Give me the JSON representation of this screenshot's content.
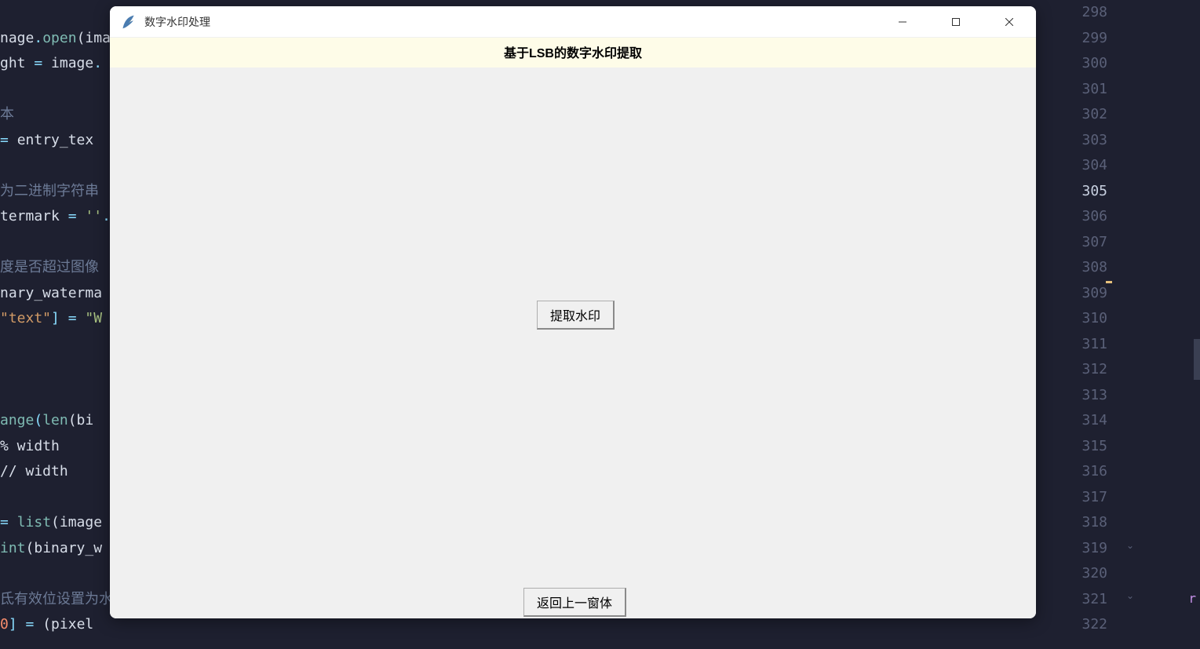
{
  "code_left": {
    "lines": [
      {
        "frag": [
          {
            "t": "",
            "c": ""
          }
        ]
      },
      {
        "frag": [
          {
            "t": "nage",
            "c": "c-var"
          },
          {
            "t": ".",
            "c": "c-op"
          },
          {
            "t": "open",
            "c": "c-func"
          },
          {
            "t": "(ima",
            "c": "c-var"
          }
        ]
      },
      {
        "frag": [
          {
            "t": "ght ",
            "c": "c-var"
          },
          {
            "t": "= ",
            "c": "c-op"
          },
          {
            "t": "image",
            "c": "c-var"
          },
          {
            "t": ".",
            "c": "c-op"
          }
        ]
      },
      {
        "frag": [
          {
            "t": "",
            "c": ""
          }
        ]
      },
      {
        "frag": [
          {
            "t": "本",
            "c": "c-comment"
          }
        ]
      },
      {
        "frag": [
          {
            "t": "= ",
            "c": "c-op"
          },
          {
            "t": "entry_tex",
            "c": "c-var"
          }
        ]
      },
      {
        "frag": [
          {
            "t": "",
            "c": ""
          }
        ]
      },
      {
        "frag": [
          {
            "t": "为二进制字符串",
            "c": "c-comment"
          }
        ]
      },
      {
        "frag": [
          {
            "t": "termark ",
            "c": "c-var"
          },
          {
            "t": "= ",
            "c": "c-op"
          },
          {
            "t": "''",
            "c": "c-str"
          },
          {
            "t": ".",
            "c": "c-op"
          }
        ]
      },
      {
        "frag": [
          {
            "t": "",
            "c": ""
          }
        ]
      },
      {
        "frag": [
          {
            "t": "度是否超过图像",
            "c": "c-comment"
          }
        ]
      },
      {
        "frag": [
          {
            "t": "nary_waterma",
            "c": "c-var"
          }
        ]
      },
      {
        "frag": [
          {
            "t": "\"text\"",
            "c": "c-orange"
          },
          {
            "t": "] ",
            "c": "c-op"
          },
          {
            "t": "= ",
            "c": "c-op"
          },
          {
            "t": "\"W",
            "c": "c-str"
          }
        ]
      },
      {
        "frag": [
          {
            "t": "",
            "c": "c-orange"
          }
        ]
      },
      {
        "frag": [
          {
            "t": "",
            "c": ""
          }
        ]
      },
      {
        "frag": [
          {
            "t": "",
            "c": ""
          }
        ]
      },
      {
        "frag": [
          {
            "t": "ange",
            "c": "c-func"
          },
          {
            "t": "(",
            "c": "c-op"
          },
          {
            "t": "len",
            "c": "c-func"
          },
          {
            "t": "(bi",
            "c": "c-var"
          }
        ]
      },
      {
        "frag": [
          {
            "t": "% width",
            "c": "c-var"
          }
        ]
      },
      {
        "frag": [
          {
            "t": "// width",
            "c": "c-var"
          }
        ]
      },
      {
        "frag": [
          {
            "t": "",
            "c": ""
          }
        ]
      },
      {
        "frag": [
          {
            "t": "= ",
            "c": "c-op"
          },
          {
            "t": "list",
            "c": "c-func"
          },
          {
            "t": "(image",
            "c": "c-var"
          }
        ]
      },
      {
        "frag": [
          {
            "t": "int",
            "c": "c-func"
          },
          {
            "t": "(binary_w",
            "c": "c-var"
          }
        ]
      },
      {
        "frag": [
          {
            "t": "",
            "c": ""
          }
        ]
      },
      {
        "frag": [
          {
            "t": "氐有效位设置为水",
            "c": "c-comment"
          }
        ]
      },
      {
        "frag": [
          {
            "t": "0",
            "c": "c-num"
          },
          {
            "t": "] ",
            "c": "c-op"
          },
          {
            "t": "= ",
            "c": "c-op"
          },
          {
            "t": "(pixel",
            "c": "c-var"
          }
        ]
      }
    ]
  },
  "line_numbers": [
    "298",
    "299",
    "300",
    "301",
    "302",
    "303",
    "304",
    "305",
    "306",
    "307",
    "308",
    "309",
    "310",
    "311",
    "312",
    "313",
    "314",
    "315",
    "316",
    "317",
    "318",
    "319",
    "320",
    "321",
    "322"
  ],
  "highlighted_line": "305",
  "window": {
    "title": "数字水印处理",
    "header": "基于LSB的数字水印提取",
    "buttons": {
      "extract": "提取水印",
      "back": "返回上一窗体"
    }
  },
  "minimap_char": "r"
}
